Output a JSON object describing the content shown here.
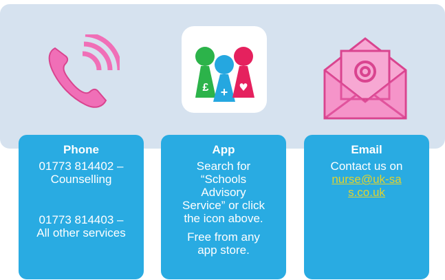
{
  "phone": {
    "title": "Phone",
    "counselling_number": "01773 814402 –",
    "counselling_label": "Counselling",
    "other_number": "01773 814403 –",
    "other_label": "All other services"
  },
  "app": {
    "title": "App",
    "line1": "Search for",
    "line2": "“Schools",
    "line3": "Advisory",
    "line4": "Service” or click",
    "line5": "the icon above.",
    "line6": "Free from any",
    "line7": "app store.",
    "logo_symbols": [
      "£",
      "+",
      "♥"
    ]
  },
  "email": {
    "title": "Email",
    "intro": "Contact us on",
    "address": "nurse@uk-sas.co.uk"
  },
  "colors": {
    "banner": "#d6e2ef",
    "card": "#29abe2",
    "icon_pink": "#f06fb7",
    "pawn_green": "#2cb34a",
    "pawn_blue": "#25a7e0",
    "pawn_pink": "#e5215e",
    "link": "#e2d32c"
  },
  "icons": [
    "phone-icon",
    "app-logo-icon",
    "email-icon"
  ]
}
